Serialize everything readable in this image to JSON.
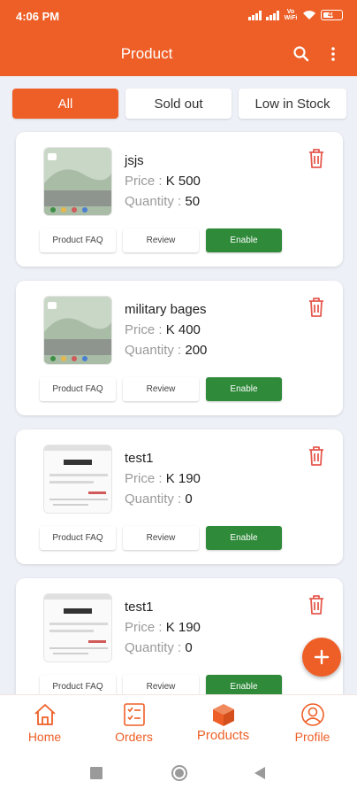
{
  "status_bar": {
    "time": "4:06 PM",
    "network_label": "Vo WiFi",
    "battery": "40"
  },
  "app_bar": {
    "title": "Product",
    "search_icon": "search-icon",
    "more_icon": "more-vert-icon"
  },
  "filters": [
    {
      "label": "All",
      "active": true
    },
    {
      "label": "Sold out",
      "active": false
    },
    {
      "label": "Low in Stock",
      "active": false
    }
  ],
  "labels": {
    "price": "Price :",
    "quantity": "Quantity :",
    "faq": "Product FAQ",
    "review": "Review",
    "enable": "Enable"
  },
  "products": [
    {
      "name": "jsjs",
      "price": "K 500",
      "quantity": "50",
      "thumb": "green-landscape"
    },
    {
      "name": "military bages",
      "price": "K 400",
      "quantity": "200",
      "thumb": "green-landscape"
    },
    {
      "name": "test1",
      "price": "K 190",
      "quantity": "0",
      "thumb": "web-screenshot"
    },
    {
      "name": "test1",
      "price": "K 190",
      "quantity": "0",
      "thumb": "web-screenshot"
    }
  ],
  "fab": {
    "icon": "plus-icon"
  },
  "bottom_nav": [
    {
      "label": "Home",
      "icon": "home-icon",
      "active": false
    },
    {
      "label": "Orders",
      "icon": "orders-icon",
      "active": false
    },
    {
      "label": "Products",
      "icon": "products-box-icon",
      "active": true
    },
    {
      "label": "Profile",
      "icon": "profile-icon",
      "active": false
    }
  ],
  "colors": {
    "brand": "#ee5f27",
    "enable_green": "#2f8a3a",
    "background": "#eef0f7",
    "delete_red": "#e55a4f"
  }
}
